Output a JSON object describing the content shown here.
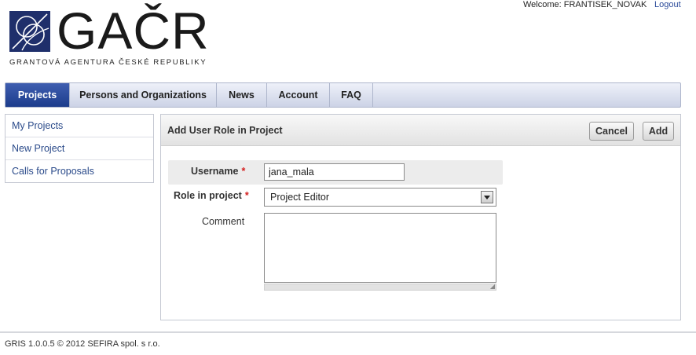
{
  "header": {
    "logo_word": "GAČR",
    "logo_subtitle": "GRANTOVÁ AGENTURA ČESKÉ REPUBLIKY",
    "welcome_text": "Welcome: FRANTISEK_NOVAK",
    "logout_label": "Logout",
    "brand_color": "#1f2f6b"
  },
  "nav": {
    "items": [
      {
        "label": "Projects",
        "active": true
      },
      {
        "label": "Persons and Organizations"
      },
      {
        "label": "News"
      },
      {
        "label": "Account"
      },
      {
        "label": "FAQ"
      }
    ]
  },
  "sidebar": {
    "items": [
      {
        "label": "My Projects"
      },
      {
        "label": "New Project"
      },
      {
        "label": "Calls for Proposals"
      }
    ]
  },
  "panel": {
    "title": "Add User Role in Project",
    "cancel_label": "Cancel",
    "add_label": "Add",
    "form": {
      "username_label": "Username",
      "username_value": "jana_mala",
      "role_label": "Role in project",
      "role_value": "Project Editor",
      "comment_label": "Comment",
      "comment_value": "",
      "required_mark": "*"
    }
  },
  "footer": {
    "text": "GRIS 1.0.0.5 © 2012 SEFIRA spol. s r.o."
  },
  "colors": {
    "nav_active": "#1c3c8c",
    "required": "#d42020",
    "link": "#2a4a8a"
  }
}
